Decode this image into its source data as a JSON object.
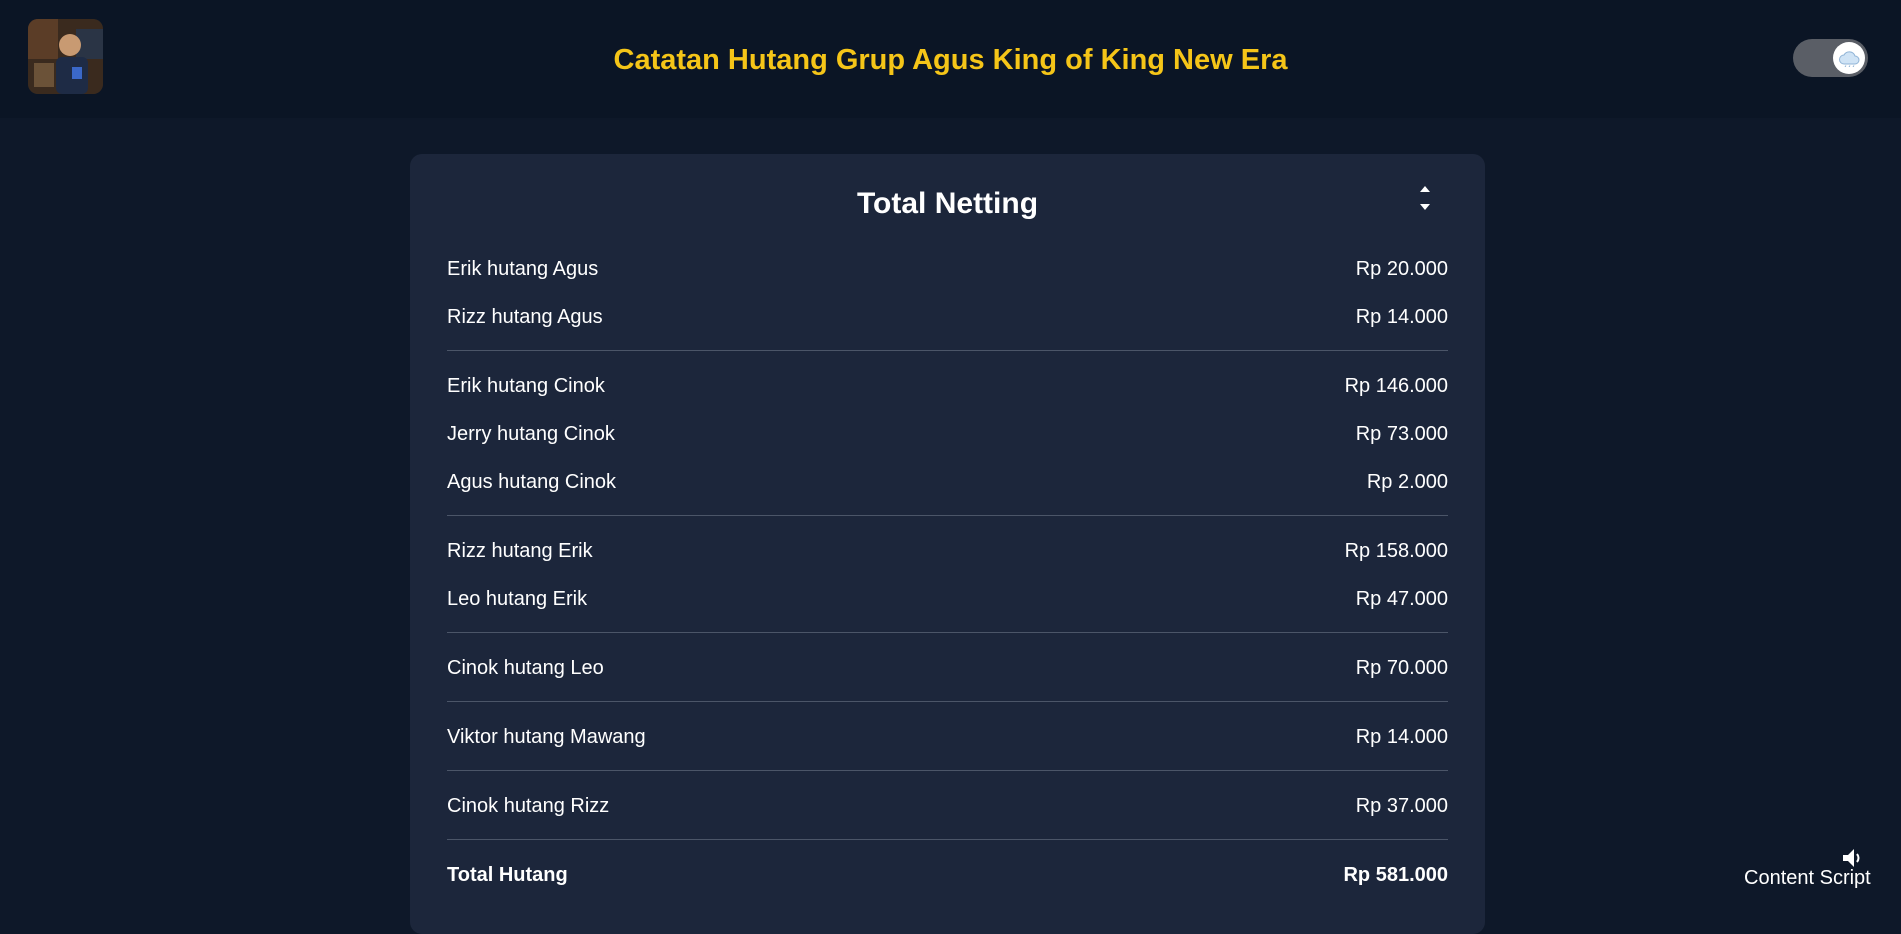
{
  "header": {
    "title": "Catatan Hutang Grup Agus King of King New Era",
    "avatar_icon": "user-photo",
    "toggle_icon": "cloud-icon"
  },
  "card": {
    "title": "Total Netting",
    "sort_icon": "sort-icon",
    "groups": [
      [
        {
          "label": "Erik hutang Agus",
          "amount": "Rp 20.000"
        },
        {
          "label": "Rizz hutang Agus",
          "amount": "Rp 14.000"
        }
      ],
      [
        {
          "label": "Erik hutang Cinok",
          "amount": "Rp 146.000"
        },
        {
          "label": "Jerry hutang Cinok",
          "amount": "Rp 73.000"
        },
        {
          "label": "Agus hutang Cinok",
          "amount": "Rp 2.000"
        }
      ],
      [
        {
          "label": "Rizz hutang Erik",
          "amount": "Rp 158.000"
        },
        {
          "label": "Leo hutang Erik",
          "amount": "Rp 47.000"
        }
      ],
      [
        {
          "label": "Cinok hutang Leo",
          "amount": "Rp 70.000"
        }
      ],
      [
        {
          "label": "Viktor hutang Mawang",
          "amount": "Rp 14.000"
        }
      ],
      [
        {
          "label": "Cinok hutang Rizz",
          "amount": "Rp 37.000"
        }
      ]
    ],
    "total": {
      "label": "Total Hutang",
      "amount": "Rp 581.000"
    }
  },
  "overlay": {
    "label": "Content Script",
    "icon": "speaker-icon"
  },
  "colors": {
    "background": "#0e1829",
    "header": "#0b1525",
    "card": "#1c263b",
    "title_accent": "#f5c518",
    "text": "#ffffff",
    "divider": "#4b5568"
  }
}
